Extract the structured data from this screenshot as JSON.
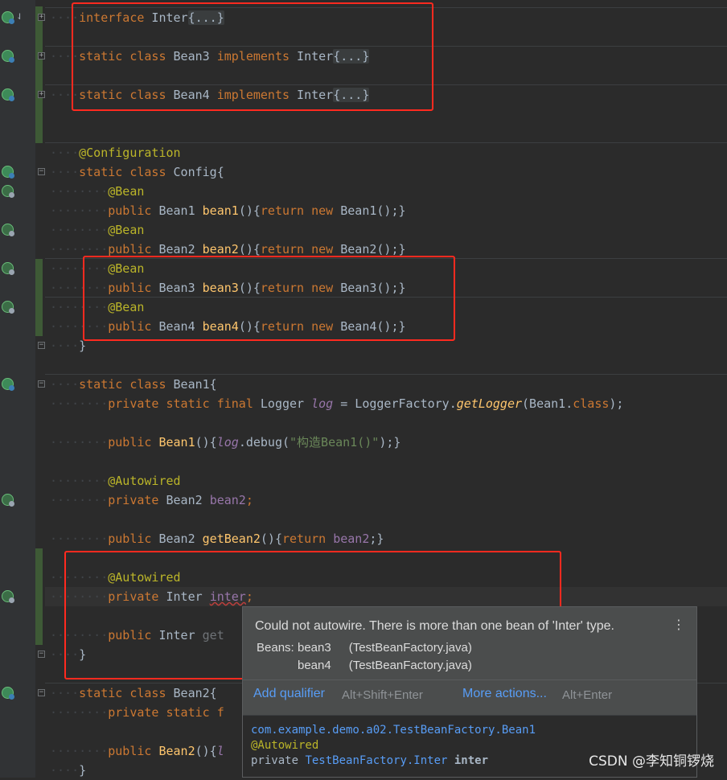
{
  "code": {
    "l1": {
      "kw": "interface",
      "name": " Inter",
      "fold": "{...}"
    },
    "l2": {
      "kw": "static class",
      "name": " Bean3 ",
      "kw2": "implements",
      "name2": " Inter",
      "fold": "{...}"
    },
    "l3": {
      "kw": "static class",
      "name": " Bean4 ",
      "kw2": "implements",
      "name2": " Inter",
      "fold": "{...}"
    },
    "config_ann": "@Configuration",
    "config_kw": "static class",
    "config_name": " Config{",
    "bean_ann": "@Bean",
    "public_kw": "public",
    "return_kw": "return",
    "new_kw": "new",
    "beans": [
      {
        "type": " Bean1 ",
        "method": "bean1",
        "ctor": " Bean1();"
      },
      {
        "type": " Bean2 ",
        "method": "bean2",
        "ctor": " Bean2();"
      },
      {
        "type": " Bean3 ",
        "method": "bean3",
        "ctor": " Bean3();"
      },
      {
        "type": " Bean4 ",
        "method": "bean4",
        "ctor": " Bean4();"
      }
    ],
    "close": "}",
    "bean1_decl_kw": "static class",
    "bean1_decl_name": " Bean1{",
    "logger_mods": "private static final",
    "logger_type": " Logger ",
    "logger_var": "log",
    "logger_eq": " = LoggerFactory.",
    "logger_fn": "getLogger",
    "logger_arg": "(Bean1.",
    "logger_class": "class",
    "logger_end": ");",
    "ctor_public": "public",
    "ctor_name": " Bean1",
    "ctor_open": "(){",
    "ctor_log": "log",
    "ctor_debug": ".debug(",
    "ctor_str": "\"构造Bean1()\"",
    "ctor_end": ");}",
    "autowired": "@Autowired",
    "private_kw": "private",
    "bean2_type": " Bean2 ",
    "bean2_field": "bean2",
    "getter_type": " Bean2 ",
    "getter_name": "getBean2",
    "getter_open": "(){",
    "getter_field": "bean2",
    "getter_end": ";}",
    "inter_type": " Inter ",
    "inter_field": "inter",
    "inter_getter_type": " Inter ",
    "inter_getter_partial": "get",
    "bean2_decl_kw": "static class",
    "bean2_decl_name": " Bean2{",
    "bean2_priv": "private static f",
    "bean2_ctor_name": "Bean2",
    "bean2_ctor_open": "(){",
    "bean2_ctor_partial": "l"
  },
  "popup": {
    "message": "Could not autowire. There is more than one bean of 'Inter' type.",
    "beans_label": "Beans:",
    "beans": [
      {
        "name": "bean3",
        "source": "(TestBeanFactory.java)"
      },
      {
        "name": "bean4",
        "source": "(TestBeanFactory.java)"
      }
    ],
    "add_qualifier": "Add qualifier",
    "add_qualifier_shortcut": "Alt+Shift+Enter",
    "more_actions": "More actions...",
    "more_actions_shortcut": "Alt+Enter",
    "doc_class": "com.example.demo.a02.TestBeanFactory.Bean1",
    "doc_annotation": "@Autowired",
    "doc_private": "private ",
    "doc_type": "TestBeanFactory.Inter",
    "doc_field": " inter"
  },
  "watermark": "CSDN @李知铜锣烧",
  "colors": {
    "highlight_box": "#ff2a1f",
    "link": "#589df6",
    "keyword": "#cc7832",
    "annotation": "#bbb529"
  }
}
